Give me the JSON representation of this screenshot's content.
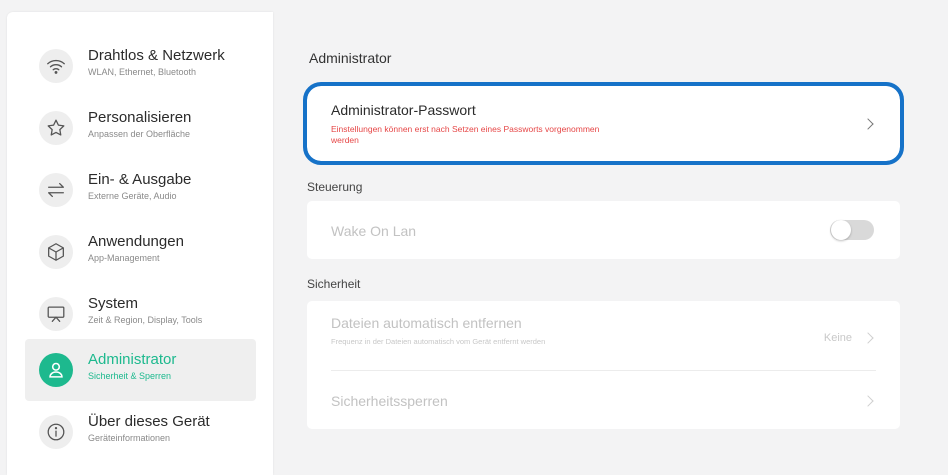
{
  "sidebar": {
    "items": [
      {
        "title": "Drahtlos & Netzwerk",
        "subtitle": "WLAN, Ethernet, Bluetooth",
        "icon": "wifi-icon"
      },
      {
        "title": "Personalisieren",
        "subtitle": "Anpassen der Oberfläche",
        "icon": "star-icon"
      },
      {
        "title": "Ein- & Ausgabe",
        "subtitle": "Externe Geräte, Audio",
        "icon": "swap-arrows-icon"
      },
      {
        "title": "Anwendungen",
        "subtitle": "App-Management",
        "icon": "cube-icon"
      },
      {
        "title": "System",
        "subtitle": "Zeit & Region, Display, Tools",
        "icon": "presentation-screen-icon"
      },
      {
        "title": "Administrator",
        "subtitle": "Sicherheit & Sperren",
        "icon": "user-icon",
        "active": true
      },
      {
        "title": "Über dieses Gerät",
        "subtitle": "Geräteinformationen",
        "icon": "info-icon"
      }
    ]
  },
  "main": {
    "heading": "Administrator",
    "password_card": {
      "title": "Administrator-Passwort",
      "note": "Einstellungen können erst nach Setzen eines Passworts vorgenommen werden"
    },
    "steuerung": {
      "label": "Steuerung",
      "wake_on_lan": "Wake On Lan",
      "wake_on_lan_enabled": false
    },
    "sicherheit": {
      "label": "Sicherheit",
      "auto_remove_title": "Dateien automatisch entfernen",
      "auto_remove_note": "Frequenz in der Dateien automatisch vom Gerät entfernt werden",
      "auto_remove_value": "Keine",
      "locks_title": "Sicherheitssperren"
    }
  },
  "colors": {
    "accent": "#1db98e",
    "highlight": "#1672c8",
    "warning": "#e64747"
  }
}
